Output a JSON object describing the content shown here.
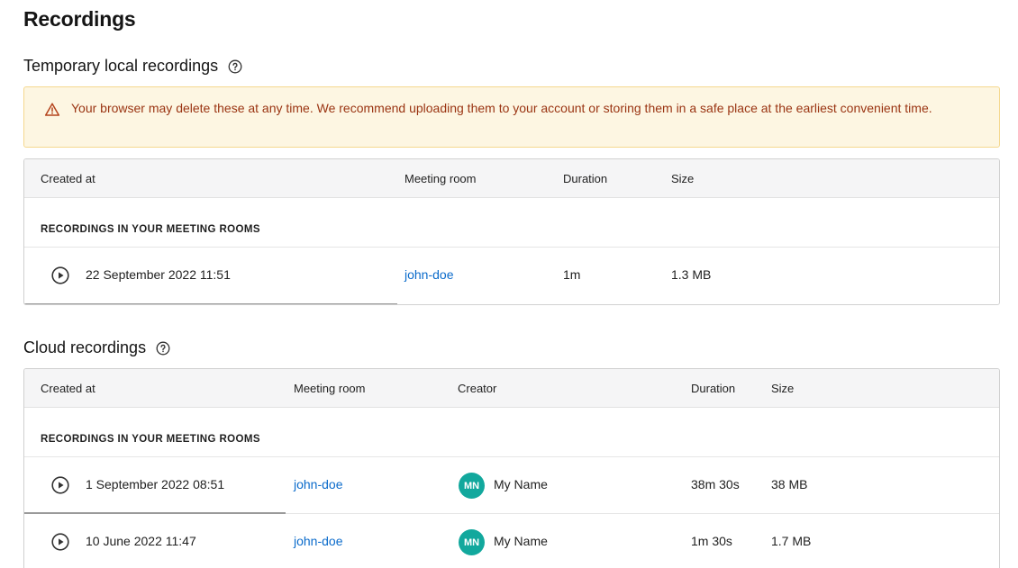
{
  "page": {
    "title": "Recordings"
  },
  "local": {
    "title": "Temporary local recordings",
    "warning": "Your browser may delete these at any time. We recommend uploading them to your account or storing them in a safe place at the earliest convenient time.",
    "columns": {
      "created": "Created at",
      "room": "Meeting room",
      "duration": "Duration",
      "size": "Size"
    },
    "group_label": "RECORDINGS IN YOUR MEETING ROOMS",
    "rows": [
      {
        "created": "22 September 2022 11:51",
        "room": "john-doe",
        "duration": "1m",
        "size": "1.3 MB"
      }
    ]
  },
  "cloud": {
    "title": "Cloud recordings",
    "columns": {
      "created": "Created at",
      "room": "Meeting room",
      "creator": "Creator",
      "duration": "Duration",
      "size": "Size"
    },
    "group_label": "RECORDINGS IN YOUR MEETING ROOMS",
    "rows": [
      {
        "created": "1 September 2022 08:51",
        "room": "john-doe",
        "avatar": "MN",
        "creator": "My Name",
        "duration": "38m 30s",
        "size": "38 MB"
      },
      {
        "created": "10 June 2022 11:47",
        "room": "john-doe",
        "avatar": "MN",
        "creator": "My Name",
        "duration": "1m 30s",
        "size": "1.7 MB"
      }
    ]
  },
  "colors": {
    "link": "#0b6bcb",
    "avatar": "#12a89d",
    "warning_bg": "#fdf6e2",
    "warning_text": "#9a3412"
  },
  "icons": {
    "help": "help-circle-icon",
    "warning": "warning-triangle-icon",
    "play": "play-circle-icon"
  }
}
